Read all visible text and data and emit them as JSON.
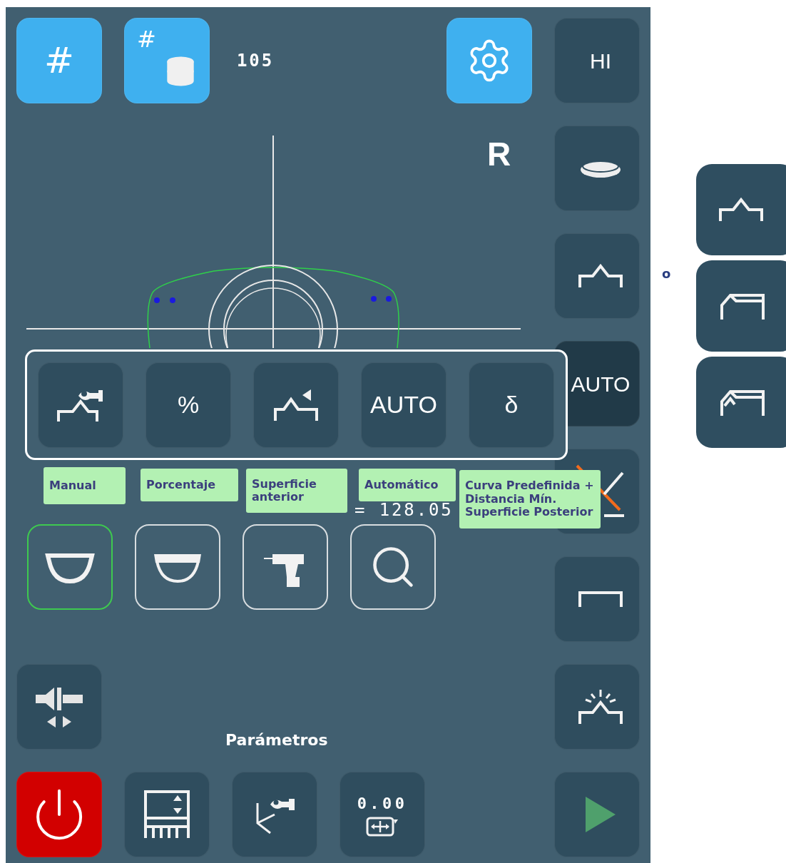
{
  "top_bar": {
    "buttons": [
      {
        "kind": "hash",
        "label": "#"
      },
      {
        "kind": "hash-database",
        "label": "#"
      }
    ],
    "counter": "105"
  },
  "side_label": "R",
  "right_toolbar": [
    {
      "kind": "text",
      "label": "HI",
      "selected": false
    },
    {
      "kind": "lens",
      "selected": false
    },
    {
      "kind": "roof",
      "selected": false
    },
    {
      "kind": "text",
      "label": "AUTO",
      "selected": true
    },
    {
      "kind": "bevel-angle",
      "selected": false
    },
    {
      "kind": "groove",
      "selected": false
    },
    {
      "kind": "polish",
      "selected": false
    },
    {
      "kind": "play",
      "selected": false
    }
  ],
  "bevel_popup": {
    "options": [
      {
        "kind": "manual",
        "tooltip": [
          "Manual"
        ]
      },
      {
        "kind": "text",
        "label": "%",
        "tooltip": [
          "Porcentaje"
        ]
      },
      {
        "kind": "front",
        "tooltip": [
          "Superficie",
          "anterior"
        ]
      },
      {
        "kind": "text",
        "label": "AUTO",
        "tooltip": [
          "Automático"
        ]
      },
      {
        "kind": "text",
        "label": "δ",
        "tooltip": [
          "Curva Predefinida +",
          "Distancia Mín.",
          "Superficie Posterior"
        ]
      }
    ]
  },
  "reading": "= 128.05",
  "frame_types": [
    {
      "kind": "full-rim",
      "selected": true
    },
    {
      "kind": "half-rim",
      "selected": false
    },
    {
      "kind": "drill",
      "selected": false
    },
    {
      "kind": "search",
      "selected": false
    }
  ],
  "section_label": "Parámetros",
  "bottom_bar": [
    {
      "kind": "power"
    },
    {
      "kind": "edit-table"
    },
    {
      "kind": "manual-angle"
    },
    {
      "kind": "value",
      "label": "0.00"
    }
  ],
  "bevel_choices": {
    "separator": "o",
    "buttons": [
      {
        "kind": "roof"
      },
      {
        "kind": "front-bevel"
      },
      {
        "kind": "double-bevel"
      }
    ]
  }
}
